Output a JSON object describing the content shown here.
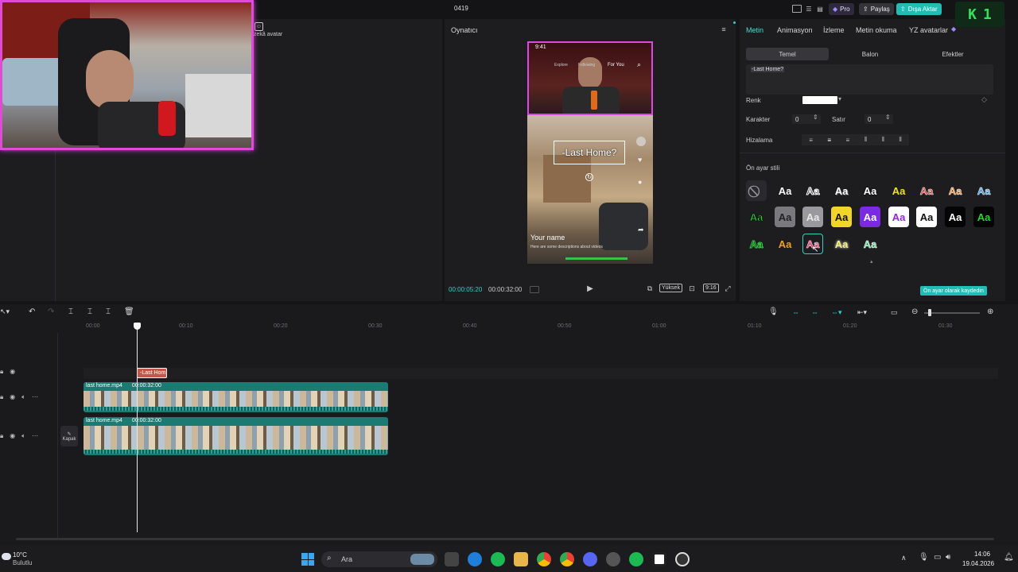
{
  "topbar": {
    "project_title": "0419",
    "pro_label": "Pro",
    "share_label": "Paylaş",
    "export_label": "Dışa Aktar",
    "badge_text": "1"
  },
  "leftpanel": {
    "avatar_label": "zekâ avatar"
  },
  "player": {
    "title": "Oynatıcı",
    "time_current": "00:00:05:20",
    "time_total": "00:00:32:00",
    "quality_label": "Yüksek",
    "ratio_label": "9:16",
    "phone": {
      "time": "9:41",
      "tab_explore": "Explore",
      "tab_following": "Following",
      "tab_foryou": "For You",
      "caption": "-Last Home?",
      "username": "Your name",
      "description": "Here are some descriptions about videos"
    }
  },
  "props": {
    "tabs": [
      "Metin",
      "Animasyon",
      "İzleme",
      "Metin okuma",
      "YZ avatarlar"
    ],
    "subtabs": [
      "Temel",
      "Balon",
      "Efektler"
    ],
    "text_value": "-Last Home?",
    "color_label": "Renk",
    "char_label": "Karakter",
    "char_value": "0",
    "line_label": "Satır",
    "line_value": "0",
    "align_label": "Hizalama",
    "preset_label": "Ön ayar stili",
    "save_preset_label": "Ön ayar olarak kaydedin",
    "preset_glyph": "Aa",
    "colors": {
      "accent": "#1fc8c0",
      "active_tab": "#4fd8cf"
    }
  },
  "timeline": {
    "ruler": [
      "00:00",
      "00:10",
      "00:20",
      "00:30",
      "00:40",
      "00:50",
      "01:00",
      "01:10",
      "01:20",
      "01:30"
    ],
    "text_clip": "-Last Hom",
    "clip1_name": "last home.mp4",
    "clip1_duration": "00:00:32:00",
    "clip2_name": "last home.mp4",
    "clip2_duration": "00:00:32:00",
    "cover_label": "Kapak"
  },
  "taskbar": {
    "weather_temp": "10°C",
    "weather_desc": "Bulutlu",
    "search_label": "Ara",
    "time": "14:06",
    "date": "19.04.2026"
  }
}
